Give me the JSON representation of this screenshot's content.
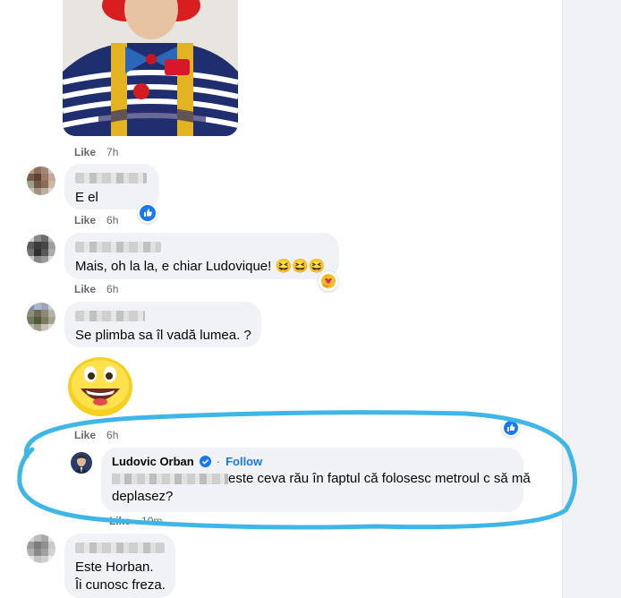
{
  "colors": {
    "accent": "#1877f2",
    "highlight_ring": "#3fb6e8",
    "bubble_bg": "#f0f2f5"
  },
  "comments": [
    {
      "id": "c0",
      "like_label": "Like",
      "time": "7h"
    },
    {
      "id": "c1",
      "text": "E el",
      "like_label": "Like",
      "time": "6h",
      "reaction_icon": "like-icon"
    },
    {
      "id": "c2",
      "text": "Mais, oh la la, e chiar Ludovique! 😆😆😆",
      "like_label": "Like",
      "time": "6h",
      "reaction_icon": "care-icon"
    },
    {
      "id": "c3",
      "text": "Se plimba sa îl vadă lumea. ?",
      "like_label": "Like",
      "time": "6h",
      "sticker": "grinning-face-sticker"
    },
    {
      "id": "c5",
      "text_line1": "Este Horban.",
      "text_line2": "Îi cunosc freza."
    }
  ],
  "reply": {
    "author": "Ludovic Orban",
    "verified_icon": "verified-badge-icon",
    "follow_label": "Follow",
    "separator": "·",
    "text_part1": "este ceva rău în faptul că folosesc metroul c să mă",
    "text_part2": "deplasez?",
    "like_label": "Like",
    "time": "10m"
  }
}
